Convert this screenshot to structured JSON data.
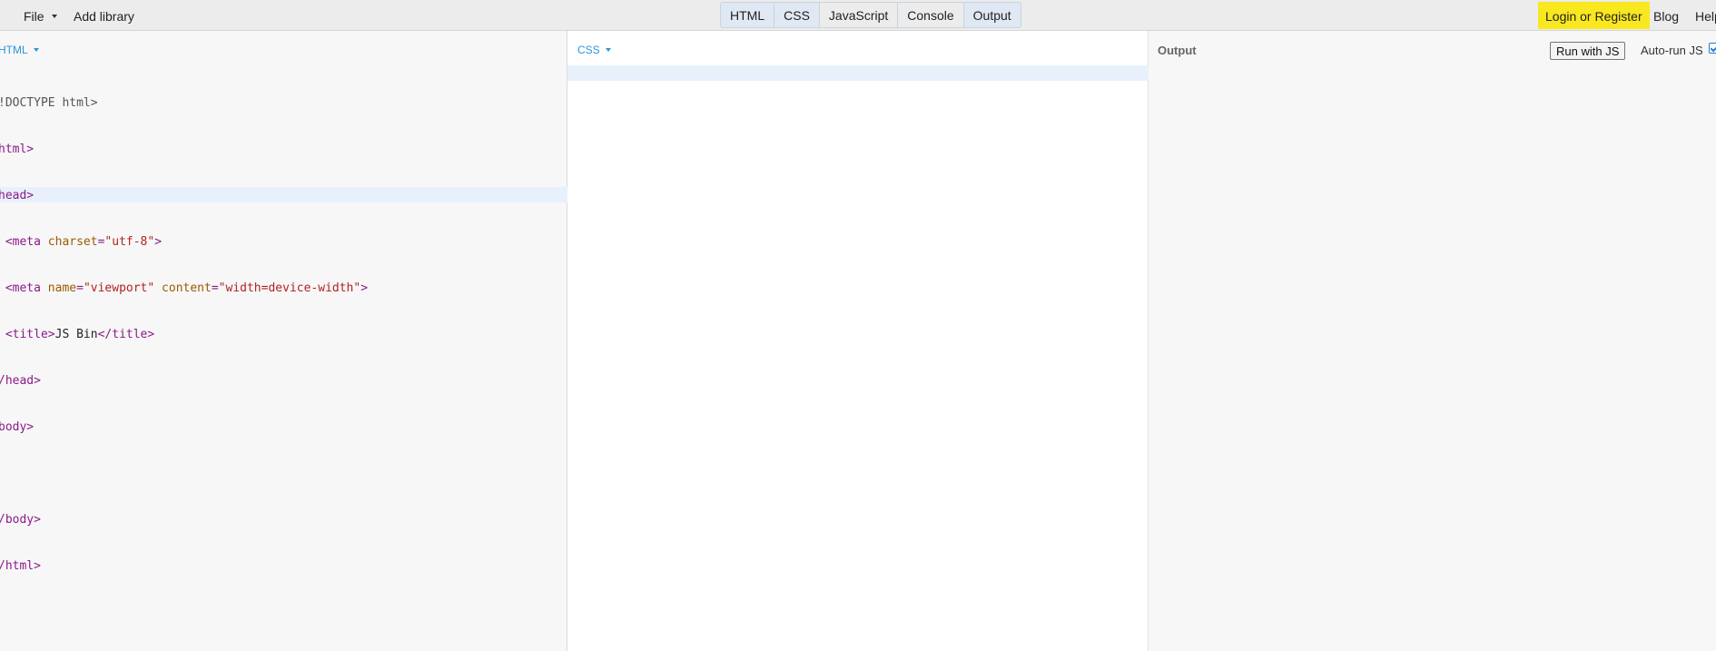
{
  "toolbar": {
    "file_label": "File",
    "add_library_label": "Add library",
    "panel_tabs": [
      "HTML",
      "CSS",
      "JavaScript",
      "Console",
      "Output"
    ],
    "login_label": "Login or Register",
    "blog_label": "Blog",
    "help_label": "Help",
    "login_color": "#f9e81f"
  },
  "html_panel": {
    "label": "HTML",
    "code_lines": [
      "!DOCTYPE html>",
      "html>",
      "head>",
      " <meta charset=\"utf-8\">",
      " <meta name=\"viewport\" content=\"width=device-width\">",
      " <title>JS Bin</title>",
      "/head>",
      "body>",
      "",
      "/body>",
      "/html>"
    ]
  },
  "css_panel": {
    "label": "CSS"
  },
  "output_panel": {
    "label": "Output",
    "run_button_label": "Run with JS",
    "autorun_label": "Auto-run JS",
    "autorun_checked": true
  },
  "colors": {
    "accent": "#2a95d8",
    "active_line": "#e8f1fb"
  }
}
